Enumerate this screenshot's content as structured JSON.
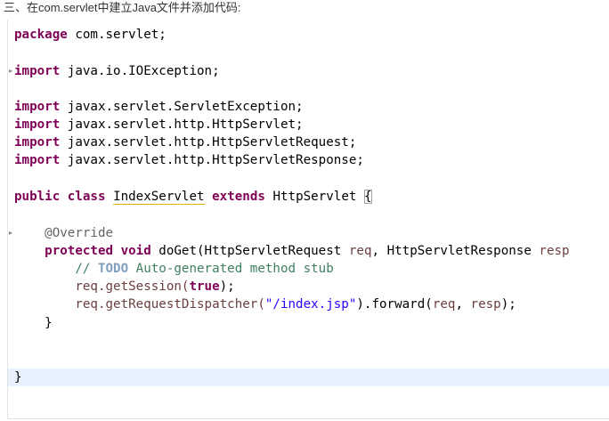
{
  "heading": "三、在com.servlet中建立Java文件并添加代码:",
  "code": {
    "package_kw": "package",
    "package_name": " com.servlet;",
    "import_kw": "import",
    "imports": [
      " java.io.IOException;",
      " javax.servlet.ServletException;",
      " javax.servlet.http.HttpServlet;",
      " javax.servlet.http.HttpServletRequest;",
      " javax.servlet.http.HttpServletResponse;"
    ],
    "class_public": "public",
    "class_kw": "class",
    "class_name": "IndexServlet",
    "extends_kw": "extends",
    "superclass": "HttpServlet",
    "open_brace": "{",
    "annotation": "@Override",
    "method_protected": "protected",
    "method_void": "void",
    "method_sig": " doGet(HttpServletRequest ",
    "param_req": "req",
    "method_sig_2": ", HttpServletResponse ",
    "param_resp": "resp",
    "comment_prefix": "// ",
    "comment_todo": "TODO",
    "comment_rest": " Auto-generated method stub",
    "session_call_start": "req.getSession(",
    "true_kw": "true",
    "session_call_end": ");",
    "dispatch_call_start": "req.getRequestDispatcher(",
    "dispatch_string": "\"/index.jsp\"",
    "dispatch_call_mid": ").forward(",
    "dispatch_arg_req": "req",
    "dispatch_comma": ", ",
    "dispatch_arg_resp": "resp",
    "dispatch_call_end": ");",
    "method_close": "}",
    "class_close": "}"
  }
}
